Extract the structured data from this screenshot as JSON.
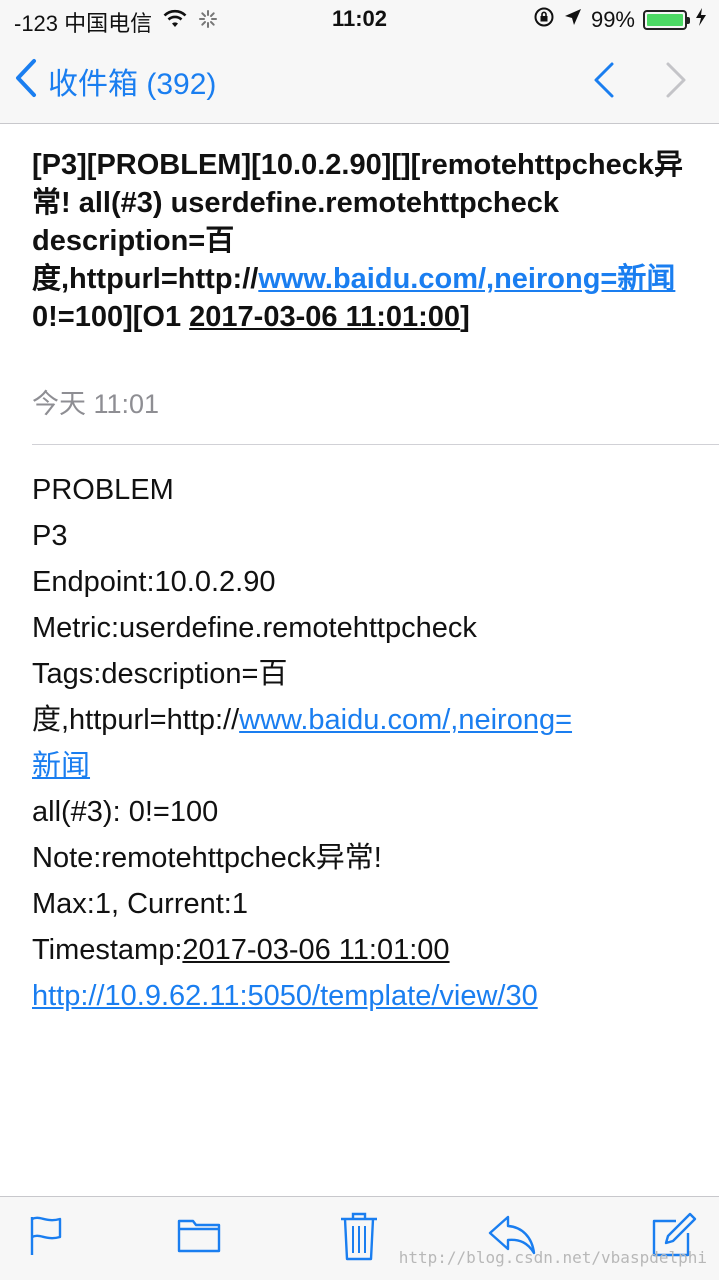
{
  "status_bar": {
    "carrier": "-123 中国电信",
    "time": "11:02",
    "battery_percent": "99%",
    "battery_level": 0.99,
    "icons": [
      "wifi-icon",
      "activity-spinner-icon",
      "rotation-lock-icon",
      "location-arrow-icon",
      "battery-icon",
      "charging-bolt-icon"
    ]
  },
  "nav": {
    "back_label": "收件箱 (392)",
    "accent": "#1a7ef0"
  },
  "email": {
    "subject_parts": {
      "p1": "[P3][PROBLEM][10.0.2.90][][remotehttpcheck异常! all(#3) userdefine.remotehttpcheck description=百度,httpurl=http://",
      "link": "www.baidu.com/,neirong=新闻",
      "p2": " 0!=100][O1 ",
      "timestamp": "2017-03-06 11:01:00",
      "p3": "]"
    },
    "date": "今天 11:01",
    "body": {
      "line1": "PROBLEM",
      "line2": "P3",
      "line3": "Endpoint:10.0.2.90",
      "line4": "Metric:userdefine.remotehttpcheck",
      "line5": "Tags:description=百",
      "line6_text": "度,httpurl=http://",
      "line6_link": "www.baidu.com/,neirong=",
      "line7_link": "新闻",
      "line8": "all(#3): 0!=100",
      "line9": "Note:remotehttpcheck异常!",
      "line10": "Max:1, Current:1",
      "line11_label": "Timestamp:",
      "line11_value": "2017-03-06 11:01:00",
      "line12_link": "http://10.9.62.11:5050/template/view/30"
    }
  },
  "toolbar": {
    "icons": [
      "flag-icon",
      "folder-icon",
      "trash-icon",
      "reply-icon",
      "compose-icon"
    ]
  },
  "watermark": "http://blog.csdn.net/vbaspdelphi"
}
